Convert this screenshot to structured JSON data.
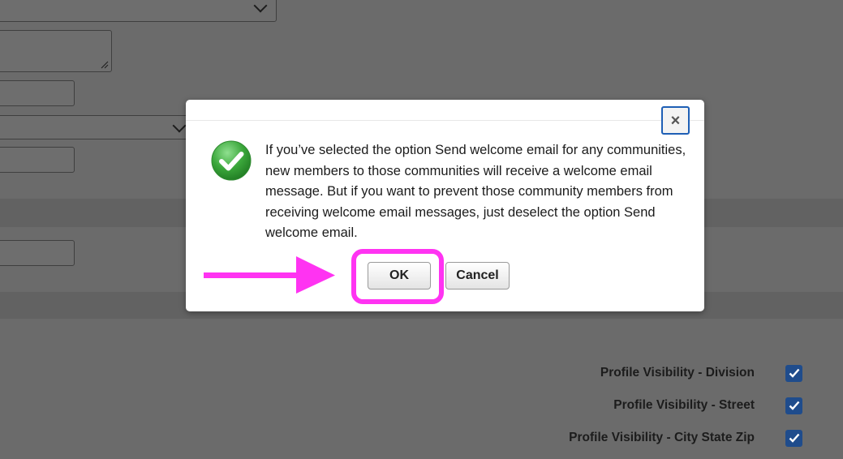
{
  "dialog": {
    "message": "If you’ve selected the option Send welcome email for any communities, new members to those communities will receive a welcome email message. But if you want to prevent those community members from receiving welcome email messages, just deselect the option Send welcome email.",
    "ok_label": "OK",
    "cancel_label": "Cancel",
    "close_label": "×"
  },
  "background_form": {
    "visibility_fields": [
      {
        "label": "Profile Visibility - Division",
        "checked": true
      },
      {
        "label": "Profile Visibility - Street",
        "checked": true
      },
      {
        "label": "Profile Visibility - City State Zip",
        "checked": true
      }
    ]
  },
  "colors": {
    "overlay": "#6b6b6b",
    "annotation": "#ff33f2",
    "focus_ring": "#1e5fb5",
    "checkbox": "#1f4c8c",
    "success_green": "#3aa63a"
  },
  "icons": {
    "success": "check-circle-icon",
    "close": "close-icon",
    "annotation_arrow": "arrow-right-icon"
  }
}
